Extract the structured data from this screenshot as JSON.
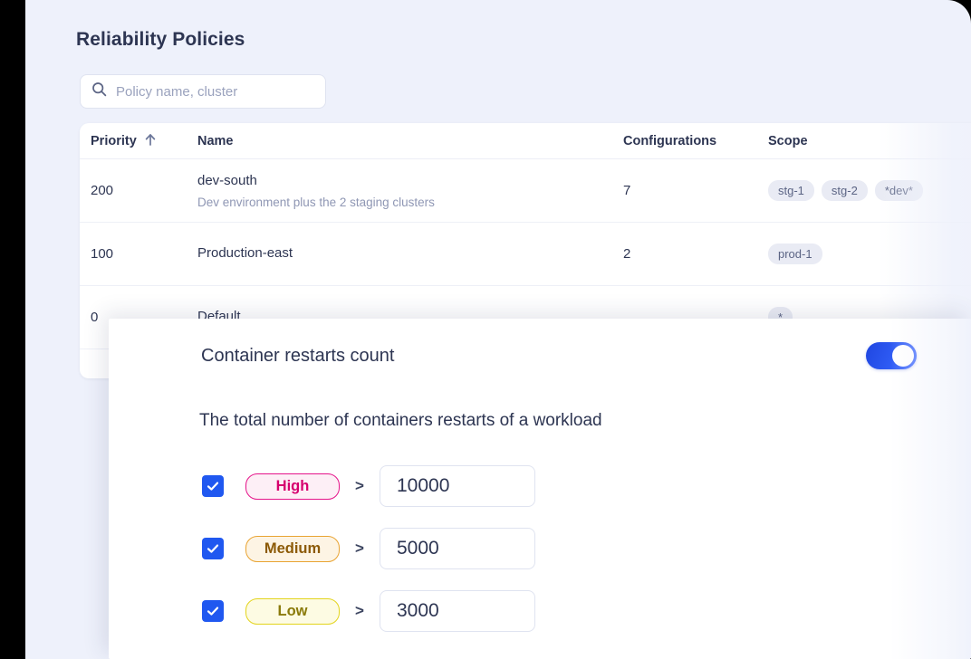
{
  "page": {
    "title": "Reliability Policies",
    "background_color": "#eef1fb",
    "accent_color": "#2058f0"
  },
  "search": {
    "placeholder": "Policy name, cluster",
    "value": "",
    "icon": "search-icon"
  },
  "table": {
    "sort": {
      "column": "Priority",
      "direction": "ascending",
      "icon": "arrow-up-icon"
    },
    "columns": [
      {
        "key": "priority",
        "label": "Priority"
      },
      {
        "key": "name",
        "label": "Name"
      },
      {
        "key": "configurations",
        "label": "Configurations"
      },
      {
        "key": "scope",
        "label": "Scope"
      }
    ],
    "rows": [
      {
        "priority": "200",
        "name": "dev-south",
        "description": "Dev environment plus the 2 staging clusters",
        "configurations": "7",
        "scope": [
          "stg-1",
          "stg-2",
          "*dev*"
        ]
      },
      {
        "priority": "100",
        "name": "Production-east",
        "description": "",
        "configurations": "2",
        "scope": [
          "prod-1"
        ]
      },
      {
        "priority": "0",
        "name": "Default",
        "description": "",
        "configurations": "",
        "scope": [
          "*"
        ]
      }
    ]
  },
  "modal": {
    "title": "Container restarts count",
    "enabled": true,
    "toggle_icon": "toggle-on-icon",
    "description": "The total number of containers restarts of a workload",
    "operator": ">",
    "severities": [
      {
        "id": "high",
        "label": "High",
        "checked": true,
        "operator": ">",
        "threshold": "10000",
        "text_color": "#d6006e",
        "border_color": "#e5148a",
        "bg_color": "#fdeff6"
      },
      {
        "id": "medium",
        "label": "Medium",
        "checked": true,
        "operator": ">",
        "threshold": "5000",
        "text_color": "#8c5a06",
        "border_color": "#e9a433",
        "bg_color": "#fdf4e4"
      },
      {
        "id": "low",
        "label": "Low",
        "checked": true,
        "operator": ">",
        "threshold": "3000",
        "text_color": "#8a7a0a",
        "border_color": "#e3d41d",
        "bg_color": "#fdfbe3"
      }
    ]
  }
}
